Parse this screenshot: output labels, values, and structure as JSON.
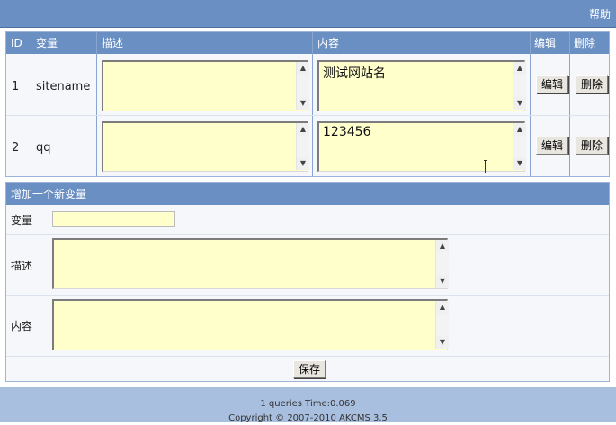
{
  "top_bar": {
    "help_label": "帮助"
  },
  "vars_table": {
    "headers": {
      "id": "ID",
      "name": "变量",
      "description": "描述",
      "content": "内容",
      "edit": "编辑",
      "delete": "删除"
    },
    "rows": [
      {
        "id": "1",
        "name": "sitename",
        "description": "",
        "content": "测试网站名",
        "edit_label": "编辑",
        "delete_label": "删除"
      },
      {
        "id": "2",
        "name": "qq",
        "description": "",
        "content": "123456",
        "edit_label": "编辑",
        "delete_label": "删除"
      }
    ]
  },
  "add_form": {
    "title": "增加一个新变量",
    "name_label": "变量",
    "name_value": "",
    "description_label": "描述",
    "description_value": "",
    "content_label": "内容",
    "content_value": "",
    "save_label": "保存"
  },
  "footer": {
    "queries": "1 queries Time:0.069",
    "copyright": "Copyright © 2007-2010 AKCMS 3.5"
  }
}
